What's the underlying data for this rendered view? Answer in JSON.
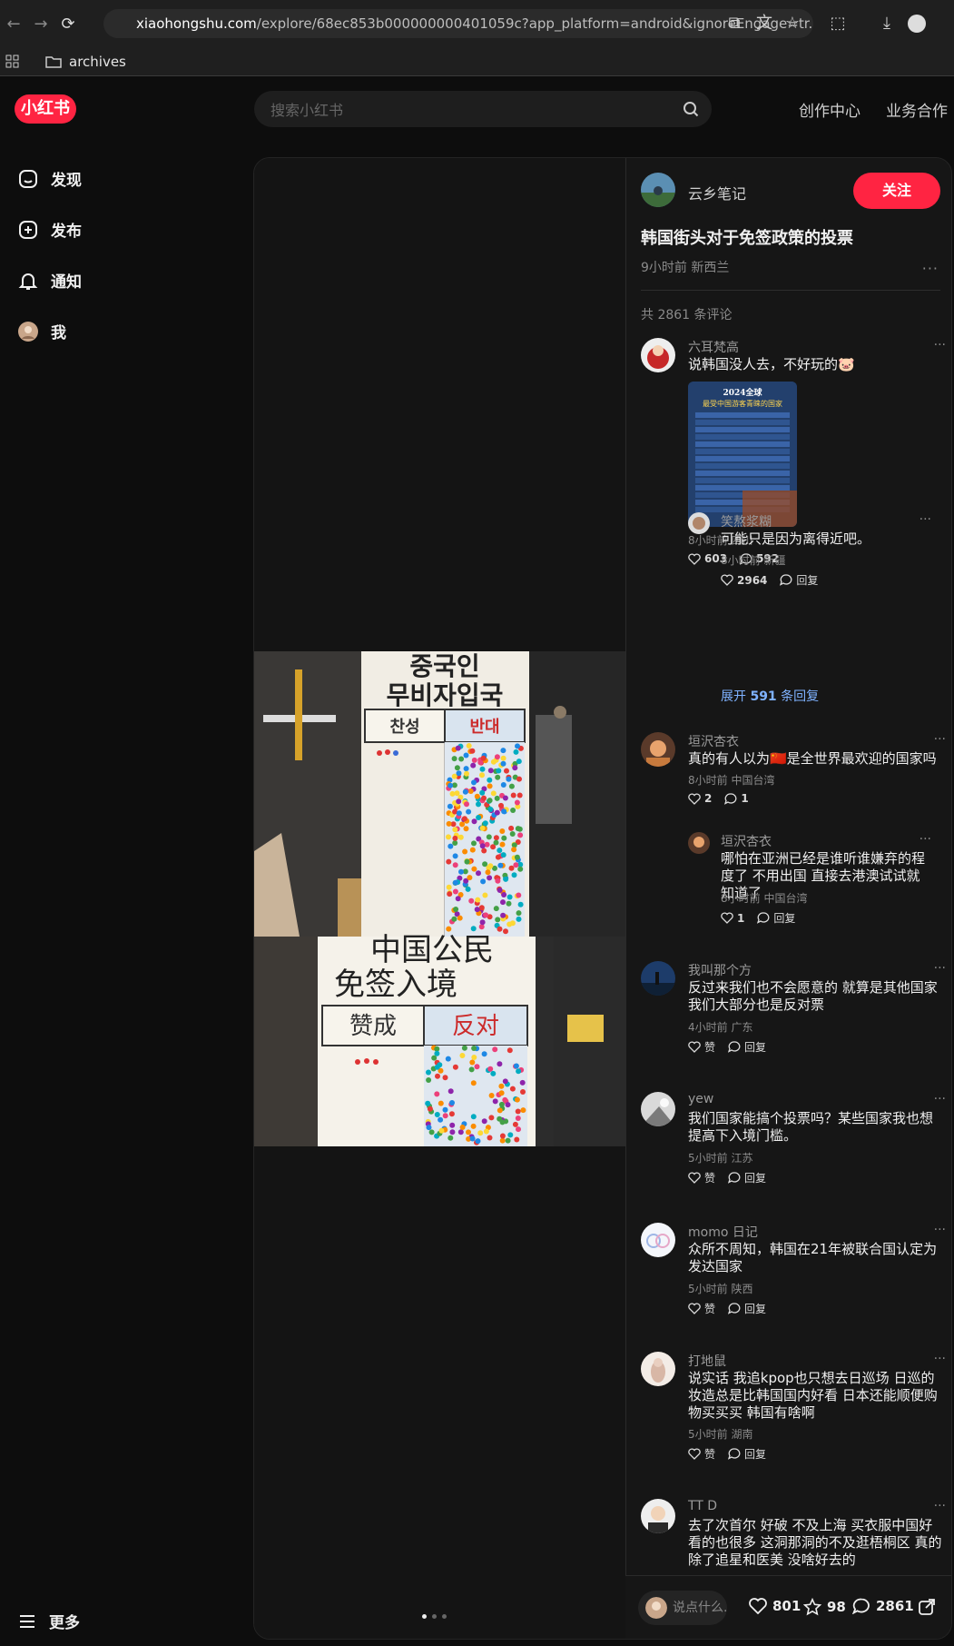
{
  "browser": {
    "url_host": "xiaohongshu.com",
    "url_path": "/explore/68ec853b000000000401059c?app_platform=android&ignoreEngage=tr...",
    "bookmark_folder": "archives"
  },
  "app": {
    "logo_text": "小红书",
    "search_placeholder": "搜索小红书",
    "top_links": [
      "创作中心",
      "业务合作"
    ],
    "sidebar": [
      {
        "label": "发现",
        "icon": "discover-icon"
      },
      {
        "label": "发布",
        "icon": "publish-icon"
      },
      {
        "label": "通知",
        "icon": "bell-icon"
      },
      {
        "label": "我",
        "icon": "avatar"
      }
    ],
    "more_label": "更多",
    "brand_color": "#ff2442"
  },
  "post": {
    "author": "云乡笔记",
    "follow_label": "关注",
    "title": "韩国街头对于免签政策的投票",
    "meta": "9小时前 新西兰",
    "comment_count_label": "共 2861 条评论",
    "image_text": {
      "korean_title_1": "중국인",
      "korean_title_2": "무비자입국",
      "korean_yes": "찬성",
      "korean_no": "반대",
      "chinese_title_1": "中国公民",
      "chinese_title_2": "免签入境",
      "chinese_yes": "赞成",
      "chinese_no": "反对"
    },
    "image_index": 1,
    "image_total": 3
  },
  "comments": [
    {
      "name": "六耳梵高",
      "text": "说韩国没人去，不好玩的🐷",
      "meta": "8小时前 四川",
      "likes": "603",
      "replies": "592",
      "image_text": {
        "title_1": "2024全球",
        "title_2": "最受中国游客青睐的国家"
      },
      "reply": {
        "name": "笑熬浆糊",
        "text": "可能只是因为离得近吧。",
        "meta": "8小时前 新疆",
        "likes": "2964",
        "reply_label": "回复"
      },
      "expand_label": "展开",
      "expand_count": "591",
      "expand_suffix": "条回复"
    },
    {
      "name": "垣沢杏衣",
      "text": "真的有人以为🇨🇳是全世界最欢迎的国家吗",
      "meta": "8小时前 中国台湾",
      "likes": "2",
      "replies": "1",
      "reply": {
        "name": "垣沢杏衣",
        "text": "哪怕在亚洲已经是谁听谁嫌弃的程度了 不用出国 直接去港澳试试就知道了",
        "meta": "8小时前 中国台湾",
        "likes": "1",
        "reply_label": "回复"
      }
    },
    {
      "name": "我叫那个方",
      "text": "反过来我们也不会愿意的 就算是其他国家 我们大部分也是反对票",
      "meta": "4小时前 广东",
      "likes": "赞",
      "replies": "回复"
    },
    {
      "name": "yew",
      "text": "我们国家能搞个投票吗？某些国家我也想提高下入境门槛。",
      "meta": "5小时前 江苏",
      "likes": "赞",
      "replies": "回复"
    },
    {
      "name": "momo 日记",
      "text": "众所不周知，韩国在21年被联合国认定为发达国家",
      "meta": "5小时前 陕西",
      "likes": "赞",
      "replies": "回复"
    },
    {
      "name": "打地鼠",
      "text": "说实话 我追kpop也只想去日巡场 日巡的妆造总是比韩国国内好看 日本还能顺便购物买买买 韩国有啥啊",
      "meta": "5小时前 湖南",
      "likes": "赞",
      "replies": "回复"
    },
    {
      "name": "TT D",
      "text": "去了次首尔 好破 不及上海 买衣服中国好看的也很多 这洞那洞的不及逛梧桐区 真的除了追星和医美 没啥好去的"
    }
  ],
  "bottom": {
    "input_placeholder": "说点什么...",
    "likes": "801",
    "stars": "98",
    "comments": "2861"
  }
}
